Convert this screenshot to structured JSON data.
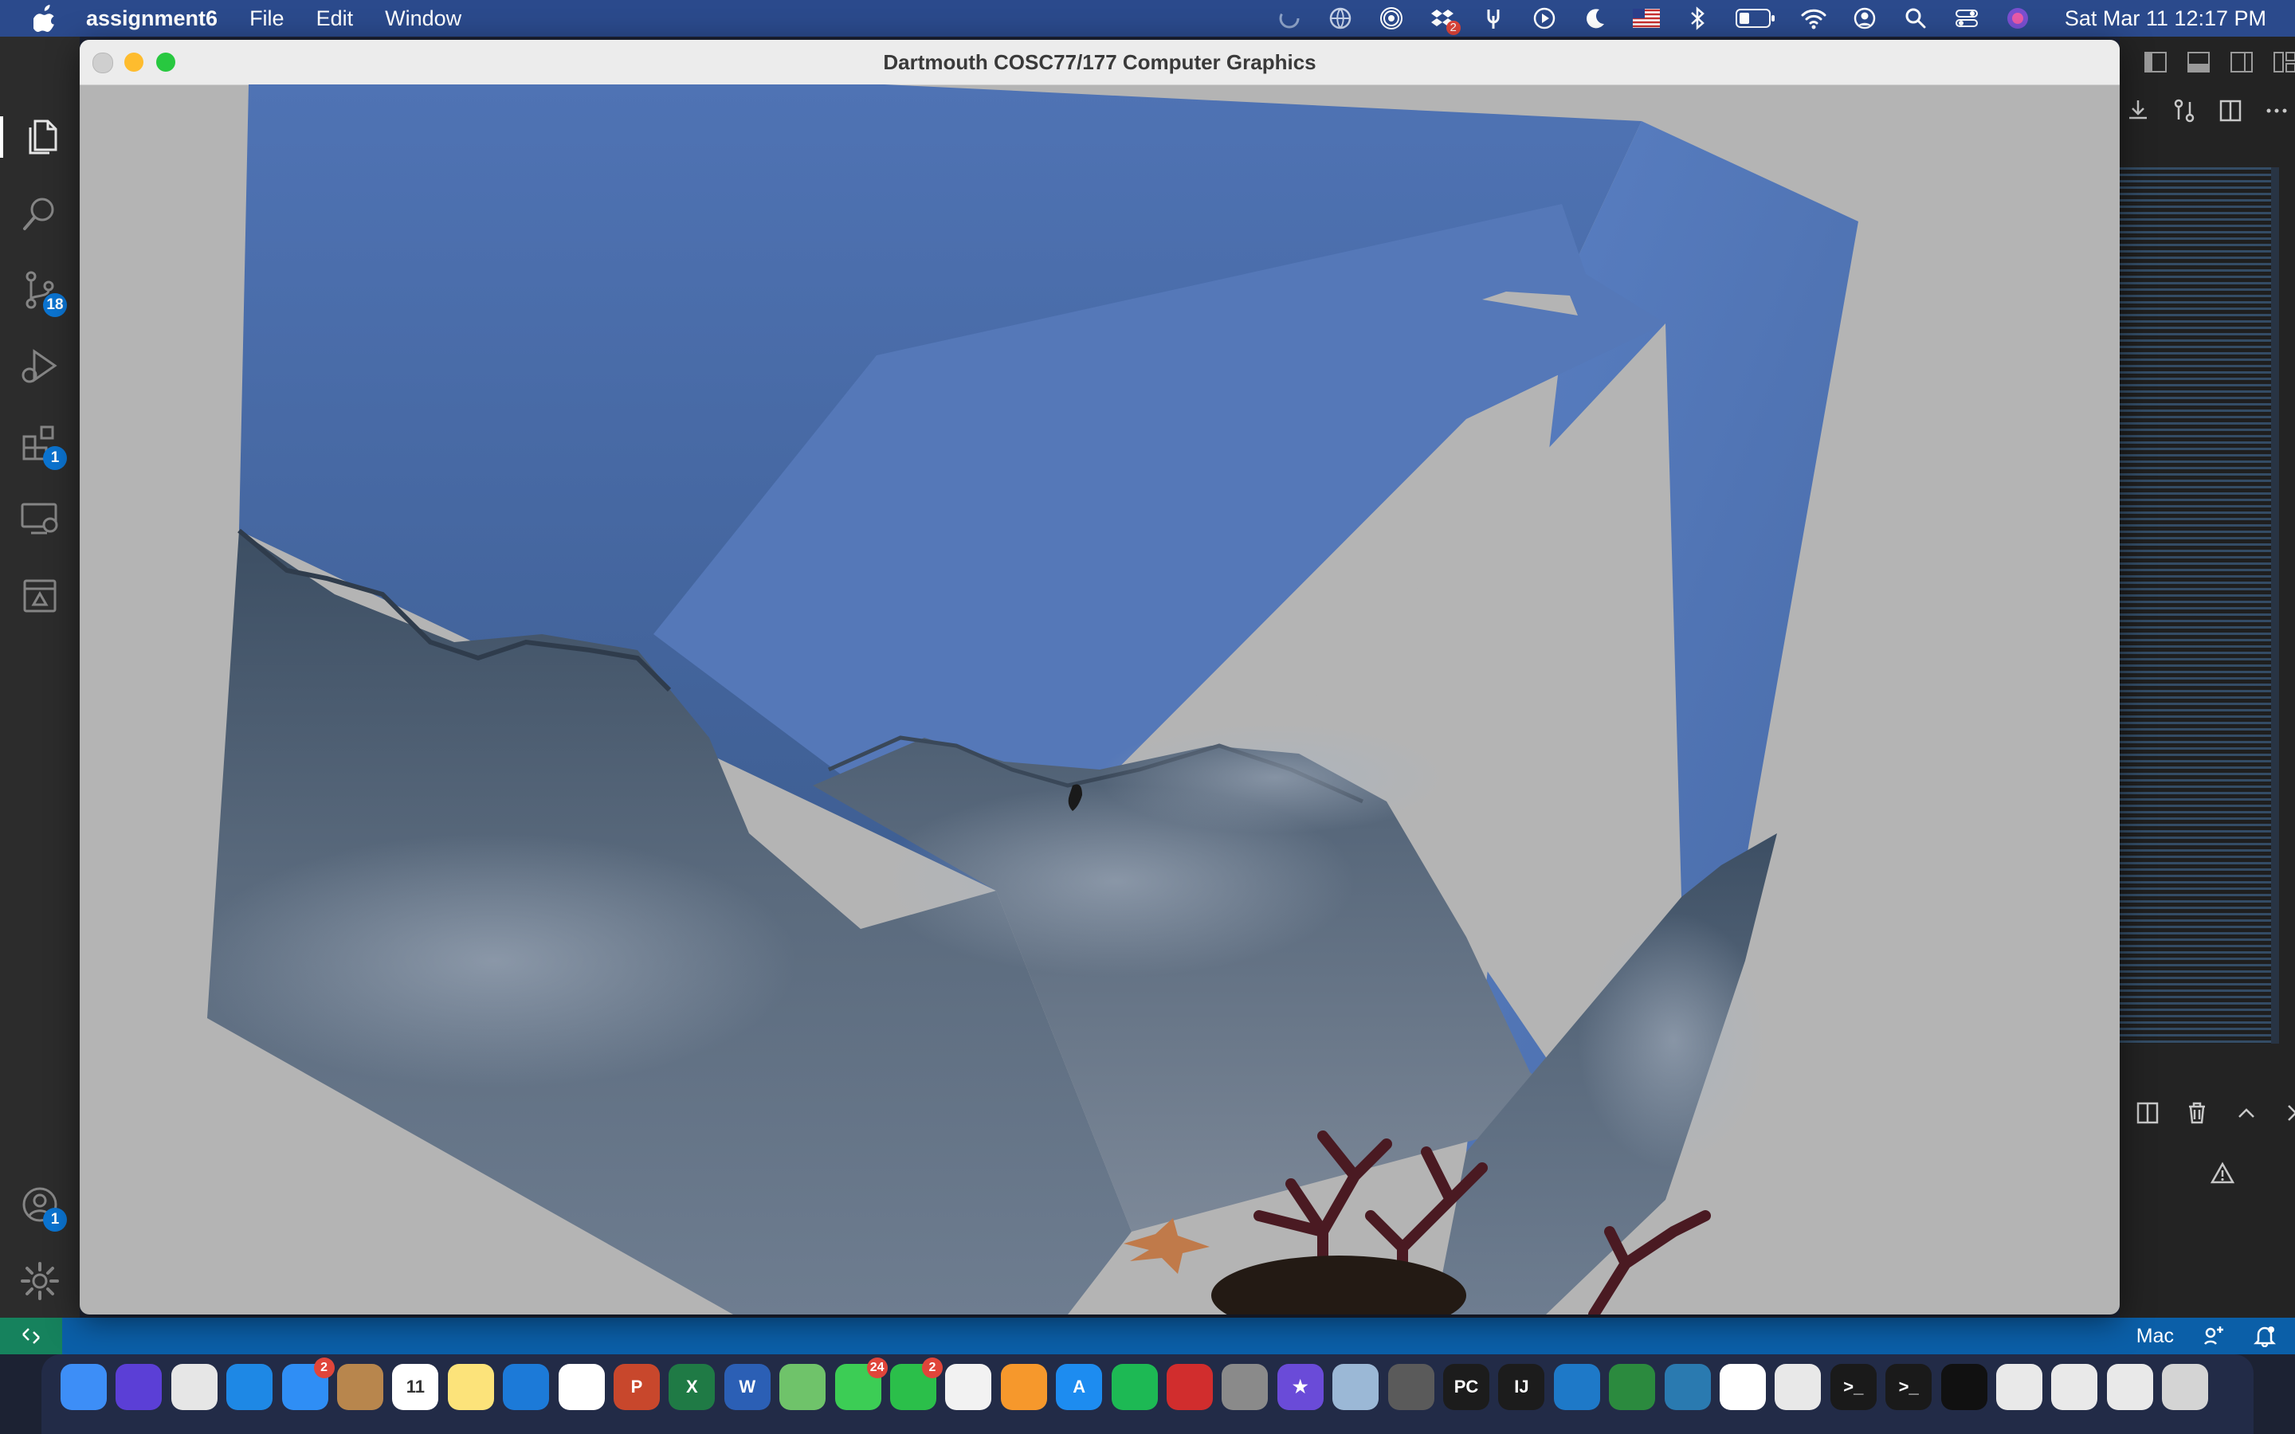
{
  "menubar": {
    "app_name": "assignment6",
    "items": [
      "File",
      "Edit",
      "Window"
    ],
    "status_badge_count": "2",
    "clock": "Sat Mar 11  12:17 PM"
  },
  "activity_bar": {
    "items": [
      {
        "name": "explorer",
        "badge": ""
      },
      {
        "name": "search",
        "badge": ""
      },
      {
        "name": "source-control",
        "badge": "18"
      },
      {
        "name": "run-debug",
        "badge": ""
      },
      {
        "name": "extensions",
        "badge": "1"
      },
      {
        "name": "remote-explorer",
        "badge": ""
      },
      {
        "name": "testing",
        "badge": ""
      }
    ],
    "accounts_badge": "1"
  },
  "app_window": {
    "title": "Dartmouth COSC77/177 Computer Graphics"
  },
  "statusbar": {
    "right_label": "Mac"
  },
  "dock": {
    "apps": [
      {
        "name": "finder",
        "color": "#3d8ef7",
        "glyph": "",
        "badge": ""
      },
      {
        "name": "siri",
        "color": "#5b3fd6",
        "glyph": "",
        "badge": ""
      },
      {
        "name": "launchpad",
        "color": "#e6e6e6",
        "glyph": "",
        "badge": ""
      },
      {
        "name": "safari",
        "color": "#1e88e5",
        "glyph": "",
        "badge": ""
      },
      {
        "name": "mail",
        "color": "#2f8ef5",
        "glyph": "",
        "badge": "2"
      },
      {
        "name": "contacts",
        "color": "#b8864d",
        "glyph": "",
        "badge": ""
      },
      {
        "name": "calendar",
        "color": "#ffffff",
        "glyph": "11",
        "badge": ""
      },
      {
        "name": "notes",
        "color": "#fce37a",
        "glyph": "",
        "badge": ""
      },
      {
        "name": "onedrive",
        "color": "#1c7ad8",
        "glyph": "",
        "badge": ""
      },
      {
        "name": "reminders",
        "color": "#ffffff",
        "glyph": "",
        "badge": ""
      },
      {
        "name": "powerpoint",
        "color": "#c8472c",
        "glyph": "P",
        "badge": ""
      },
      {
        "name": "excel",
        "color": "#1f7a45",
        "glyph": "X",
        "badge": ""
      },
      {
        "name": "word",
        "color": "#2b5fb5",
        "glyph": "W",
        "badge": ""
      },
      {
        "name": "maps",
        "color": "#6fc36a",
        "glyph": "",
        "badge": ""
      },
      {
        "name": "messages",
        "color": "#3ccd55",
        "glyph": "",
        "badge": "24"
      },
      {
        "name": "facetime",
        "color": "#2bbf4a",
        "glyph": "",
        "badge": "2"
      },
      {
        "name": "photos",
        "color": "#f2f2f2",
        "glyph": "",
        "badge": ""
      },
      {
        "name": "pages",
        "color": "#f6982c",
        "glyph": "",
        "badge": ""
      },
      {
        "name": "app-store",
        "color": "#1d8cf0",
        "glyph": "A",
        "badge": ""
      },
      {
        "name": "spotify",
        "color": "#1db954",
        "glyph": "",
        "badge": ""
      },
      {
        "name": "photo-booth",
        "color": "#d12d2d",
        "glyph": "",
        "badge": ""
      },
      {
        "name": "system-preferences",
        "color": "#8a8a8a",
        "glyph": "",
        "badge": ""
      },
      {
        "name": "imovie",
        "color": "#6a4bd8",
        "glyph": "★",
        "badge": ""
      },
      {
        "name": "preview",
        "color": "#9bb8d6",
        "glyph": "",
        "badge": ""
      },
      {
        "name": "calculator",
        "color": "#5a5a5a",
        "glyph": "",
        "badge": ""
      },
      {
        "name": "pycharm",
        "color": "#1c1c1c",
        "glyph": "PC",
        "badge": ""
      },
      {
        "name": "intellij",
        "color": "#1c1c1c",
        "glyph": "IJ",
        "badge": ""
      },
      {
        "name": "vscode",
        "color": "#1e79c8",
        "glyph": "",
        "badge": ""
      },
      {
        "name": "ring-app",
        "color": "#2b8a3e",
        "glyph": "",
        "badge": ""
      },
      {
        "name": "globe-vpn",
        "color": "#2a7ab0",
        "glyph": "",
        "badge": ""
      },
      {
        "name": "slack",
        "color": "#ffffff",
        "glyph": "",
        "badge": ""
      },
      {
        "name": "chrome",
        "color": "#e8e8e8",
        "glyph": "",
        "badge": ""
      },
      {
        "name": "terminal-1",
        "color": "#1a1a1a",
        "glyph": ">_",
        "badge": ""
      },
      {
        "name": "terminal-2",
        "color": "#1a1a1a",
        "glyph": ">_",
        "badge": ""
      },
      {
        "name": "exec-window",
        "color": "#111111",
        "glyph": "",
        "badge": ""
      },
      {
        "name": "document-1",
        "color": "#e9e9e9",
        "glyph": "",
        "badge": ""
      },
      {
        "name": "document-2",
        "color": "#e9e9e9",
        "glyph": "",
        "badge": ""
      },
      {
        "name": "document-3",
        "color": "#e9e9e9",
        "glyph": "",
        "badge": ""
      },
      {
        "name": "trash",
        "color": "#d4d4d4",
        "glyph": "",
        "badge": ""
      }
    ]
  }
}
